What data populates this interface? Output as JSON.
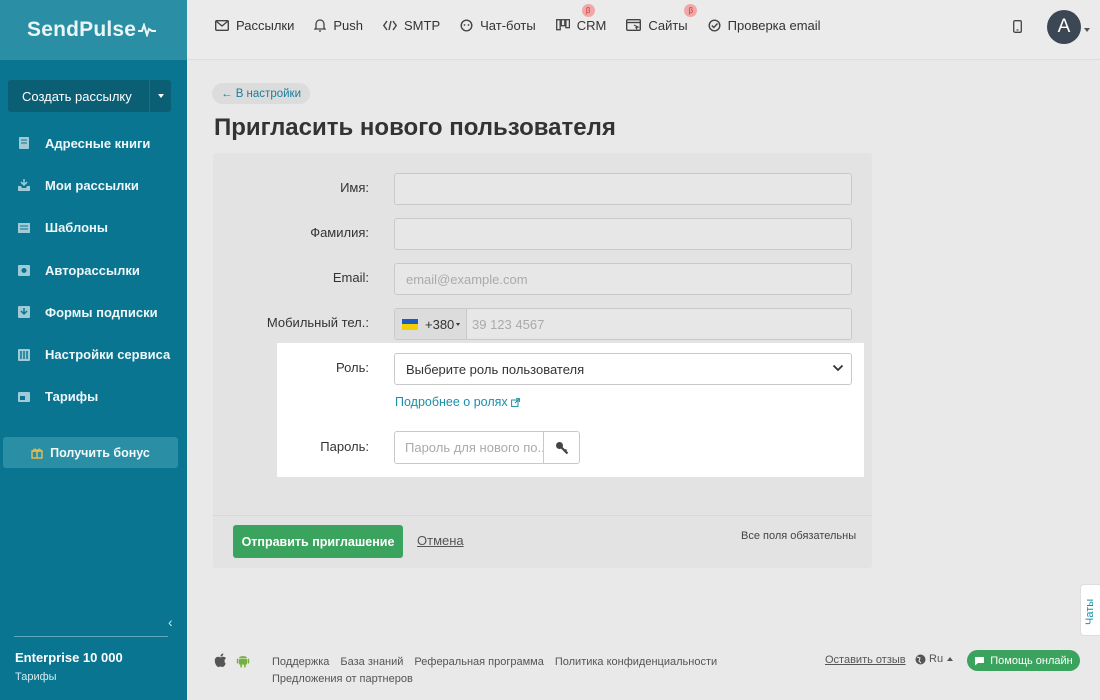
{
  "logo": "SendPulse",
  "sidebar": {
    "create_label": "Создать рассылку",
    "items": [
      {
        "label": "Адресные книги"
      },
      {
        "label": "Мои рассылки"
      },
      {
        "label": "Шаблоны"
      },
      {
        "label": "Авторассылки"
      },
      {
        "label": "Формы подписки"
      },
      {
        "label": "Настройки сервиса"
      },
      {
        "label": "Тарифы"
      }
    ],
    "bonus_label": "Получить бонус",
    "plan_name": "Enterprise 10 000",
    "plan_link": "Тарифы"
  },
  "topnav": [
    {
      "label": "Рассылки",
      "beta": ""
    },
    {
      "label": "Push",
      "beta": ""
    },
    {
      "label": "SMTP",
      "beta": ""
    },
    {
      "label": "Чат-боты",
      "beta": ""
    },
    {
      "label": "CRM",
      "beta": "β"
    },
    {
      "label": "Сайты",
      "beta": "β"
    },
    {
      "label": "Проверка email",
      "beta": ""
    }
  ],
  "user": {
    "avatar_letter": "A"
  },
  "page": {
    "back_label": "← В настройки",
    "title": "Пригласить нового пользователя"
  },
  "form": {
    "first_name_label": "Имя:",
    "first_name_value": "",
    "last_name_label": "Фамилия:",
    "last_name_value": "",
    "email_label": "Email:",
    "email_placeholder": "email@example.com",
    "phone_label": "Мобильный тел.:",
    "phone_code": "+380",
    "phone_placeholder": "39 123 4567",
    "role_label": "Роль:",
    "role_value": "Выберите роль пользователя",
    "roles_link": "Подробнее о ролях",
    "password_label": "Пароль:",
    "password_placeholder": "Пароль для нового по..."
  },
  "actions": {
    "send_label": "Отправить приглашение",
    "cancel_label": "Отмена",
    "required_note": "Все поля обязательны"
  },
  "chats_tab": "Чаты",
  "footer": {
    "links": [
      "Поддержка",
      "База знаний",
      "Реферальная программа",
      "Политика конфиденциальности",
      "Предложения от партнеров"
    ],
    "review": "Оставить отзыв",
    "lang": "Ru",
    "help_label": "Помощь онлайн"
  },
  "colors": {
    "sidebar": "#0a7590",
    "accent_link": "#1a8fa8",
    "primary_green": "#3aa35e"
  }
}
